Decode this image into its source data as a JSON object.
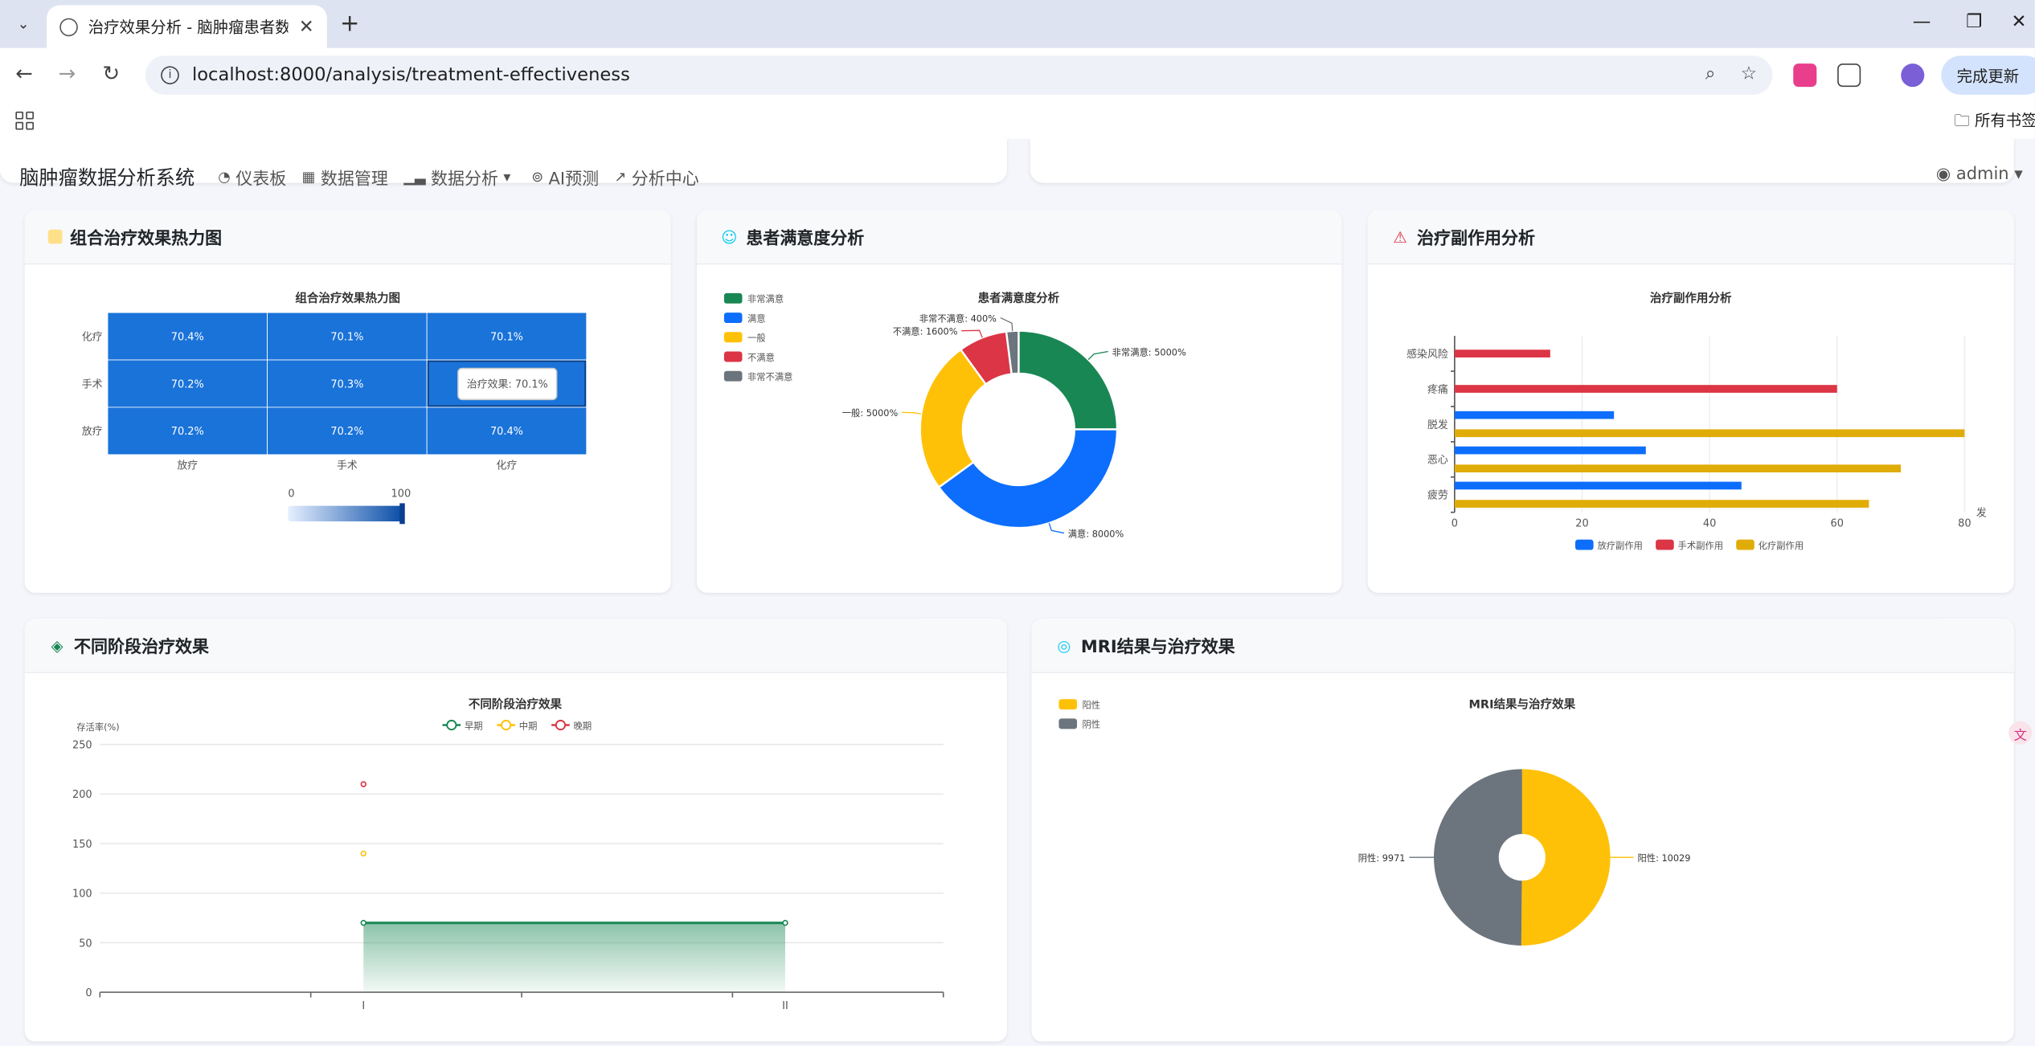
{
  "browser": {
    "tab_title": "治疗效果分析 - 脑肿瘤患者数据",
    "url_host": "localhost",
    "url_rest": ":8000/analysis/treatment-effectiveness",
    "update_label": "完成更新",
    "bookmarks_label": "所有书签"
  },
  "navbar": {
    "brand": "脑肿瘤数据分析系统",
    "items": [
      "仪表板",
      "数据管理",
      "数据分析",
      "AI预测",
      "分析中心"
    ],
    "user": "admin"
  },
  "cards": {
    "heatmap": "组合治疗效果热力图",
    "satisfaction": "患者满意度分析",
    "side_effects": "治疗副作用分析",
    "stages": "不同阶段治疗效果",
    "mri": "MRI结果与治疗效果"
  },
  "colors": {
    "blue": "#0d6efd",
    "green": "#198754",
    "yellow": "#ffc107",
    "red": "#dc3545",
    "gray": "#6c757d",
    "heat": "#1a73d9"
  },
  "chart_data": [
    {
      "type": "heatmap",
      "title": "组合治疗效果热力图",
      "x": [
        "放疗",
        "手术",
        "化疗"
      ],
      "y": [
        "化疗",
        "手术",
        "放疗"
      ],
      "values": [
        [
          "70.4%",
          "70.1%",
          "70.1%"
        ],
        [
          "70.2%",
          "70.3%",
          "70.1%"
        ],
        [
          "70.2%",
          "70.2%",
          "70.4%"
        ]
      ],
      "visual_map": {
        "min": "0",
        "max": "100"
      },
      "tooltip": "治疗效果: 70.1%"
    },
    {
      "type": "pie",
      "title": "患者满意度分析",
      "categories": [
        "非常满意",
        "满意",
        "一般",
        "不满意",
        "非常不满意"
      ],
      "values": [
        5000,
        8000,
        5000,
        1600,
        400
      ],
      "labels": [
        "非常满意: 5000%",
        "满意: 8000%",
        "一般: 5000%",
        "不满意: 1600%",
        "非常不满意: 400%"
      ]
    },
    {
      "type": "bar",
      "title": "治疗副作用分析",
      "categories": [
        "疲劳",
        "恶心",
        "脱发",
        "疼痛",
        "感染风险"
      ],
      "series": [
        {
          "name": "放疗副作用",
          "values": [
            45,
            30,
            25,
            null,
            null
          ]
        },
        {
          "name": "手术副作用",
          "values": [
            null,
            null,
            null,
            60,
            15
          ]
        },
        {
          "name": "化疗副作用",
          "values": [
            65,
            70,
            80,
            null,
            null
          ]
        }
      ],
      "xticks": [
        "0",
        "20",
        "40",
        "60",
        "80"
      ],
      "xlabel_partial": "发",
      "xlim": [
        0,
        80
      ]
    },
    {
      "type": "line",
      "title": "不同阶段治疗效果",
      "ylabel": "存活率(%)",
      "categories": [
        "I",
        "II"
      ],
      "series": [
        {
          "name": "早期",
          "values": [
            70,
            70
          ]
        },
        {
          "name": "中期",
          "values": [
            140,
            null
          ]
        },
        {
          "name": "晚期",
          "values": [
            210,
            null
          ]
        }
      ],
      "yticks": [
        "0",
        "50",
        "100",
        "150",
        "200",
        "250"
      ],
      "ylim": [
        0,
        250
      ]
    },
    {
      "type": "pie",
      "title": "MRI结果与治疗效果",
      "categories": [
        "阳性",
        "阴性"
      ],
      "values": [
        10029,
        9971
      ],
      "labels": [
        "阳性: 10029",
        "阴性: 9971"
      ]
    }
  ]
}
